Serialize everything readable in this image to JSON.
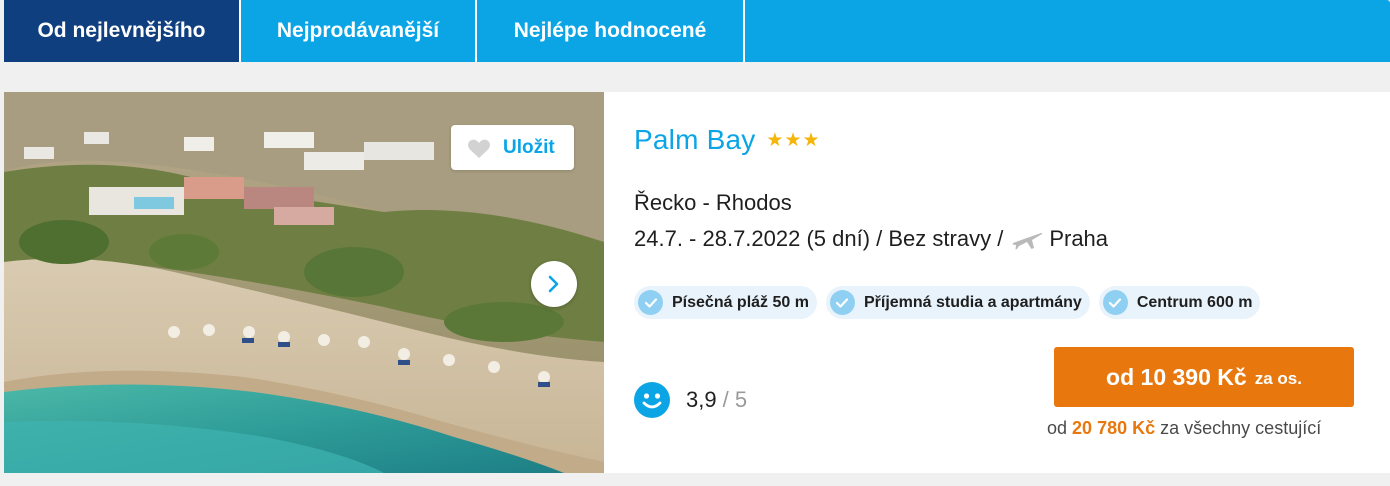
{
  "tabs": [
    {
      "label": "Od nejlevnějšího",
      "active": true
    },
    {
      "label": "Nejprodávanější",
      "active": false
    },
    {
      "label": "Nejlépe hodnocené",
      "active": false
    }
  ],
  "card": {
    "save_label": "Uložit",
    "hotel_name": "Palm Bay",
    "stars": 3,
    "destination": "Řecko - Rhodos",
    "trip_details": "24.7. - 28.7.2022 (5 dní) / Bez stravy /",
    "departure": "Praha",
    "tags": [
      "Písečná pláž 50 m",
      "Příjemná studia a apartmány",
      "Centrum 600 m"
    ],
    "rating_value": "3,9",
    "rating_max": "/ 5",
    "price_label": "od 10 390 Kč",
    "price_suffix": "za os.",
    "total_prefix": "od",
    "total_amount": "20 780 Kč",
    "total_suffix": "za všechny cestující"
  },
  "colors": {
    "brand_blue": "#0ba5e6",
    "active_tab": "#0f3f7e",
    "price_orange": "#e8780e",
    "star_gold": "#f5b60b"
  },
  "icons": [
    "heart-icon",
    "chevron-right-icon",
    "star-icon",
    "plane-icon",
    "check-icon",
    "smile-icon"
  ]
}
